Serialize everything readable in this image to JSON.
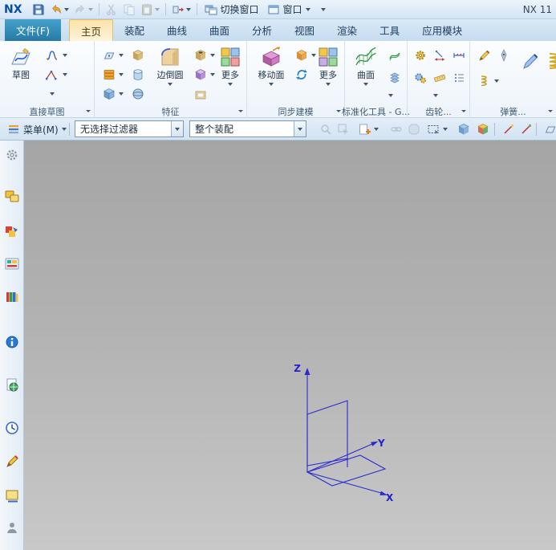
{
  "title_bar": {
    "logo": "NX",
    "switch_window": "切换窗口",
    "window": "窗口",
    "app_title": "NX 11"
  },
  "tabs": [
    {
      "label": "文件(F)"
    },
    {
      "label": "主页"
    },
    {
      "label": "装配"
    },
    {
      "label": "曲线"
    },
    {
      "label": "曲面"
    },
    {
      "label": "分析"
    },
    {
      "label": "视图"
    },
    {
      "label": "渲染"
    },
    {
      "label": "工具"
    },
    {
      "label": "应用模块"
    }
  ],
  "ribbon": {
    "groups": {
      "direct_sketch": {
        "label": "直接草图",
        "sketch": "草图"
      },
      "feature": {
        "label": "特征",
        "edge_blend": "边倒圆",
        "more": "更多"
      },
      "synchronous": {
        "label": "同步建模",
        "move_face": "移动面",
        "more": "更多"
      },
      "standard_tools": {
        "label": "标准化工具 - G...",
        "surface": "曲面"
      },
      "gear": {
        "label": "齿轮..."
      },
      "spring": {
        "label": "弹簧..."
      }
    }
  },
  "selection_bar": {
    "menu": "菜单(M)",
    "selection_filter": "无选择过滤器",
    "selection_scope": "整个装配"
  },
  "viewport": {
    "axes": {
      "x": "X",
      "y": "Y",
      "z": "Z"
    }
  },
  "colors": {
    "file_tab": "#2f7ca8",
    "active_tab_highlight": "#fbe2a9",
    "triad_blue": "#2b2bd0",
    "viewport_top": "#a5a5a5",
    "viewport_bottom": "#c8c8c8"
  }
}
